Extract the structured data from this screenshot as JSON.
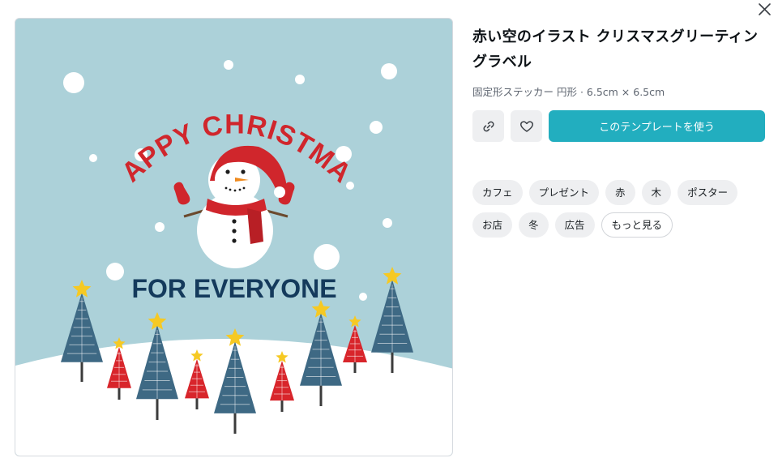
{
  "template": {
    "title": "赤い空のイラスト クリスマスグリーティングラベル",
    "meta": "固定形ステッカー 円形 · 6.5cm × 6.5cm"
  },
  "artwork": {
    "headline": "HAPPY CHRISTMAS",
    "subline": "FOR EVERYONE",
    "colors": {
      "sky": "#acd1d9",
      "snow": "#ffffff",
      "red": "#d0262c",
      "navy": "#143a5c",
      "tree_blue": "#3e6984",
      "tree_red": "#d8252b",
      "star": "#f6c923"
    }
  },
  "actions": {
    "link_icon": "link-icon",
    "favorite_icon": "heart-icon",
    "use_template_label": "このテンプレートを使う",
    "accent_color": "#22aebf"
  },
  "tags": [
    "カフェ",
    "プレゼント",
    "赤",
    "木",
    "ポスター",
    "お店",
    "冬",
    "広告"
  ],
  "more_label": "もっと見る",
  "close_icon": "close-icon"
}
